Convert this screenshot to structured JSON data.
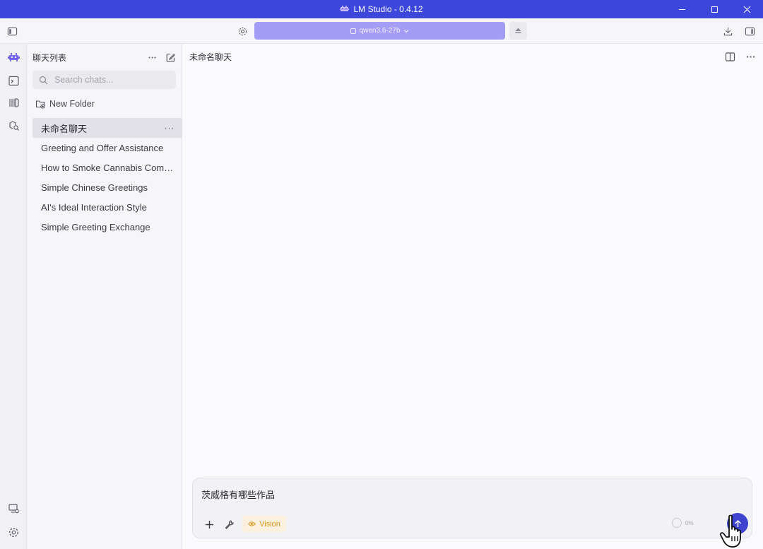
{
  "window": {
    "title": "LM Studio - 0.4.12",
    "controls": [
      "minimize-icon",
      "maximize-icon",
      "close-icon"
    ]
  },
  "toolbar": {
    "model_name": "qwen3.6-27b",
    "left_icon": "sidebar-toggle-icon",
    "right_icons": [
      "download-icon",
      "right-panel-icon"
    ]
  },
  "rail": {
    "top_icons": [
      "mascot-logo-icon",
      "terminal-icon",
      "models-icon",
      "discover-icon"
    ],
    "bottom_icons": [
      "runtime-icon",
      "settings-icon"
    ]
  },
  "sidebar": {
    "title": "聊天列表",
    "search_placeholder": "Search chats...",
    "new_folder_label": "New Folder",
    "more_label": "···",
    "chats": [
      {
        "label": "未命名聊天",
        "active": true
      },
      {
        "label": "Greeting and Offer Assistance",
        "active": false
      },
      {
        "label": "How to Smoke Cannabis Comfortably",
        "active": false
      },
      {
        "label": "Simple Chinese Greetings",
        "active": false
      },
      {
        "label": "AI's Ideal Interaction Style",
        "active": false
      },
      {
        "label": "Simple Greeting Exchange",
        "active": false
      }
    ]
  },
  "main": {
    "chat_title": "未命名聊天",
    "composer": {
      "input_text": "茨威格有哪些作品",
      "vision_label": "Vision",
      "context_usage": "0%"
    }
  },
  "colors": {
    "titlebar": "#3d47dc",
    "model_selector": "#a59cf5",
    "send_button": "#3e44cf",
    "vision_text": "#d8961e",
    "vision_bg": "#fbf0dd"
  }
}
